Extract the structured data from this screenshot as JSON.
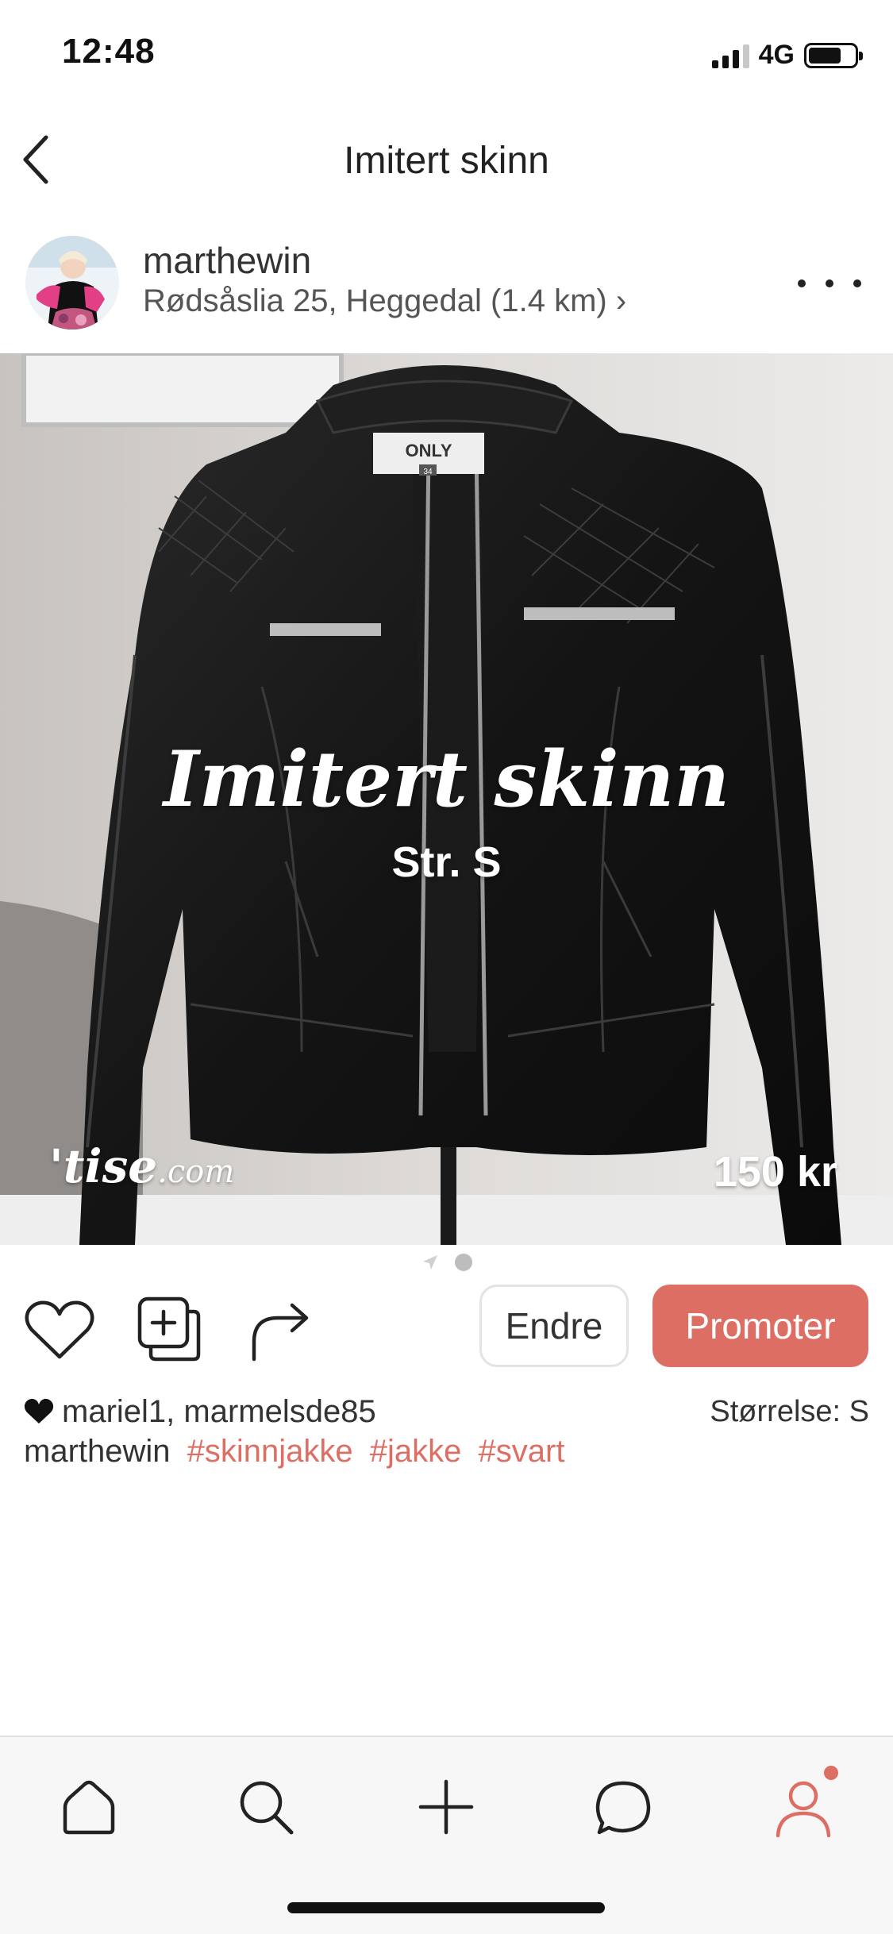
{
  "status_bar": {
    "time": "12:48",
    "network": "4G"
  },
  "nav": {
    "title": "Imitert skinn"
  },
  "seller": {
    "username": "marthewin",
    "location": "Rødsåslia 25, Heggedal (1.4 km) ›"
  },
  "product_image": {
    "overlay_title": "Imitert skinn",
    "overlay_size": "Str. S",
    "watermark_brand": "'tise",
    "watermark_domain": ".com",
    "price": "150 kr",
    "label_brand": "ONLY",
    "label_size": "34"
  },
  "actions": {
    "edit_label": "Endre",
    "promote_label": "Promoter"
  },
  "likes": {
    "users": "mariel1, marmelsde85"
  },
  "size": {
    "text": "Størrelse: S"
  },
  "caption": {
    "username": "marthewin",
    "hashtags": [
      "#skinnjakke",
      "#jakke",
      "#svart"
    ]
  },
  "colors": {
    "accent": "#dc6e63"
  },
  "icons": {
    "tabs": [
      "home-icon",
      "search-icon",
      "plus-icon",
      "chat-icon",
      "profile-icon"
    ],
    "actions": [
      "heart-icon",
      "add-to-collection-icon",
      "share-icon"
    ]
  }
}
